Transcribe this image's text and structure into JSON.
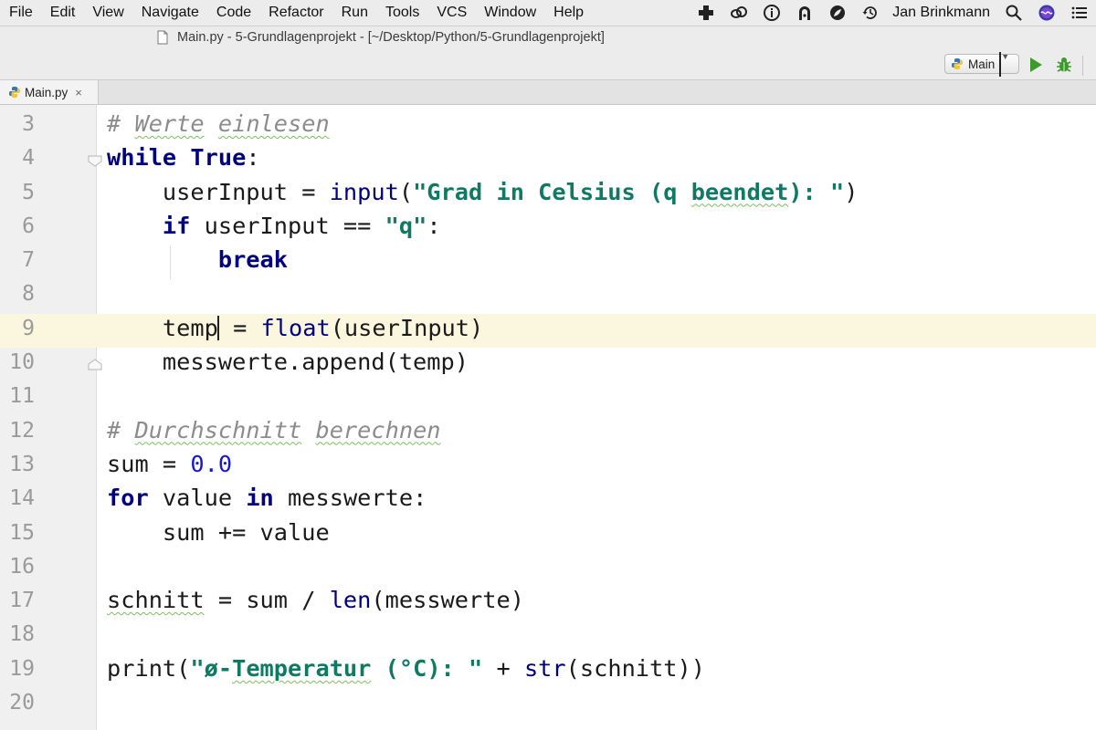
{
  "menubar": {
    "items": [
      "File",
      "Edit",
      "View",
      "Navigate",
      "Code",
      "Refactor",
      "Run",
      "Tools",
      "VCS",
      "Window",
      "Help"
    ],
    "user_name": "Jan Brinkmann"
  },
  "window": {
    "title": "Main.py - 5-Grundlagenprojekt - [~/Desktop/Python/5-Grundlagenprojekt]"
  },
  "toolbar": {
    "run_config": "Main"
  },
  "tabs": [
    {
      "label": "Main.py",
      "close": "×"
    }
  ],
  "editor": {
    "current_line": 9,
    "lines": [
      {
        "num": "3",
        "tokens": [
          {
            "t": "# ",
            "c": "cmt"
          },
          {
            "t": "Werte",
            "c": "cmt wavy"
          },
          {
            "t": " ",
            "c": "cmt"
          },
          {
            "t": "einlesen",
            "c": "cmt wavy"
          }
        ]
      },
      {
        "num": "4",
        "tokens": [
          {
            "t": "while",
            "c": "kw"
          },
          {
            "t": " "
          },
          {
            "t": "True",
            "c": "kw"
          },
          {
            "t": ":"
          }
        ]
      },
      {
        "num": "5",
        "tokens": [
          {
            "t": "    userInput = "
          },
          {
            "t": "input",
            "c": "fn"
          },
          {
            "t": "("
          },
          {
            "t": "\"Grad in Celsius (q ",
            "c": "str"
          },
          {
            "t": "beendet",
            "c": "str wavy"
          },
          {
            "t": "): \"",
            "c": "str"
          },
          {
            "t": ")"
          }
        ]
      },
      {
        "num": "6",
        "tokens": [
          {
            "t": "    "
          },
          {
            "t": "if",
            "c": "kw"
          },
          {
            "t": " userInput == "
          },
          {
            "t": "\"q\"",
            "c": "str"
          },
          {
            "t": ":"
          }
        ]
      },
      {
        "num": "7",
        "tokens": [
          {
            "t": "        "
          },
          {
            "t": "break",
            "c": "kw"
          }
        ]
      },
      {
        "num": "8",
        "tokens": []
      },
      {
        "num": "9",
        "tokens": [
          {
            "t": "    temp"
          },
          {
            "t": "",
            "c": "caret"
          },
          {
            "t": " = "
          },
          {
            "t": "float",
            "c": "fn"
          },
          {
            "t": "(userInput)"
          }
        ]
      },
      {
        "num": "10",
        "tokens": [
          {
            "t": "    messwerte.append(temp)"
          }
        ]
      },
      {
        "num": "11",
        "tokens": []
      },
      {
        "num": "12",
        "tokens": [
          {
            "t": "# ",
            "c": "cmt"
          },
          {
            "t": "Durchschnitt",
            "c": "cmt wavy"
          },
          {
            "t": " ",
            "c": "cmt"
          },
          {
            "t": "berechnen",
            "c": "cmt wavy"
          }
        ]
      },
      {
        "num": "13",
        "tokens": [
          {
            "t": "sum = "
          },
          {
            "t": "0.0",
            "c": "num"
          }
        ]
      },
      {
        "num": "14",
        "tokens": [
          {
            "t": "for",
            "c": "kw"
          },
          {
            "t": " value "
          },
          {
            "t": "in",
            "c": "kw"
          },
          {
            "t": " messwerte:"
          }
        ]
      },
      {
        "num": "15",
        "tokens": [
          {
            "t": "    sum += value"
          }
        ]
      },
      {
        "num": "16",
        "tokens": []
      },
      {
        "num": "17",
        "tokens": [
          {
            "t": "schnitt",
            "c": "wavy"
          },
          {
            "t": " = sum / "
          },
          {
            "t": "len",
            "c": "fn"
          },
          {
            "t": "(messwerte)"
          }
        ]
      },
      {
        "num": "18",
        "tokens": []
      },
      {
        "num": "19",
        "tokens": [
          {
            "t": "print(",
            "c": ""
          },
          {
            "t": "\"ø-",
            "c": "str"
          },
          {
            "t": "Temperatur",
            "c": "str wavy"
          },
          {
            "t": " (°C): \"",
            "c": "str"
          },
          {
            "t": " + "
          },
          {
            "t": "str",
            "c": "fn"
          },
          {
            "t": "(schnitt))"
          }
        ]
      },
      {
        "num": "20",
        "tokens": []
      }
    ]
  }
}
